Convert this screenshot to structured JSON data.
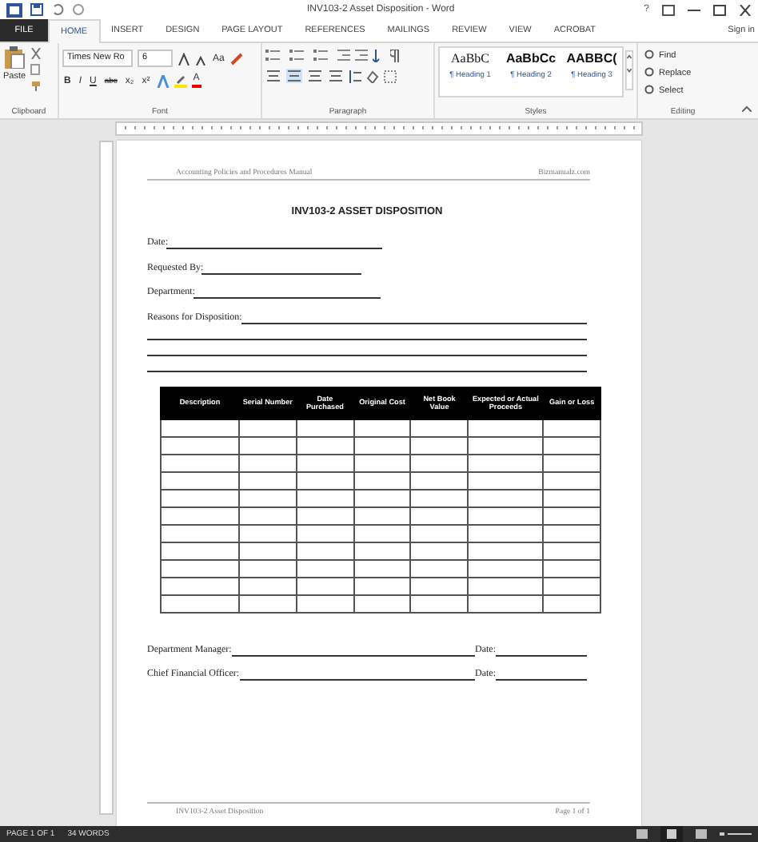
{
  "window": {
    "title": "INV103-2 Asset Disposition - Word",
    "help": "?"
  },
  "tabs": [
    {
      "label": "FILE",
      "kind": "file",
      "selected": false
    },
    {
      "label": "HOME",
      "kind": "tab",
      "selected": true
    },
    {
      "label": "INSERT",
      "kind": "tab",
      "selected": false
    },
    {
      "label": "DESIGN",
      "kind": "tab",
      "selected": false
    },
    {
      "label": "PAGE LAYOUT",
      "kind": "tab",
      "selected": false
    },
    {
      "label": "REFERENCES",
      "kind": "tab",
      "selected": false
    },
    {
      "label": "MAILINGS",
      "kind": "tab",
      "selected": false
    },
    {
      "label": "REVIEW",
      "kind": "tab",
      "selected": false
    },
    {
      "label": "VIEW",
      "kind": "tab",
      "selected": false
    },
    {
      "label": "ACROBAT",
      "kind": "tab",
      "selected": false
    }
  ],
  "account": "Sign in",
  "ribbon": {
    "clipboard": {
      "paste": "Paste",
      "group": "Clipboard"
    },
    "font": {
      "family": "Times New Ro",
      "size": "6",
      "case": "Aa",
      "buttons": [
        "B",
        "I",
        "U",
        "abc",
        "x₂",
        "x²"
      ],
      "color_button": "A",
      "group": "Font"
    },
    "paragraph": {
      "group": "Paragraph"
    },
    "styles": {
      "group": "Styles",
      "items": [
        {
          "sample": "AaBbC",
          "name": "¶ Heading 1",
          "kind": "serif"
        },
        {
          "sample": "AaBbCc",
          "name": "¶ Heading 2",
          "kind": "sans"
        },
        {
          "sample": "AABBC(",
          "name": "¶ Heading 3",
          "kind": "sans"
        }
      ]
    },
    "editing": {
      "group": "Editing",
      "items": [
        {
          "label": "Find"
        },
        {
          "label": "Replace"
        },
        {
          "label": "Select"
        }
      ]
    }
  },
  "document": {
    "header": {
      "left": "Accounting Policies and Procedures Manual",
      "right": "Bizmanualz.com"
    },
    "title": "INV103-2 ASSET DISPOSITION",
    "fields": [
      {
        "label": "Date:"
      },
      {
        "label": "Requested By:"
      },
      {
        "label": "Department:"
      }
    ],
    "reasons": {
      "label": "Reasons for Disposition:"
    },
    "table": {
      "columns": [
        "Description",
        "Serial Number",
        "Date Purchased",
        "Original Cost",
        "Net Book Value",
        "Expected or Actual Proceeds",
        "Gain or Loss"
      ]
    },
    "signatures": [
      {
        "label": "Department Manager:",
        "date_label": "Date:"
      },
      {
        "label": "Chief Financial Officer:",
        "date_label": "Date:"
      }
    ],
    "footer": {
      "left": "INV103-2 Asset Disposition",
      "right": "Page 1 of 1"
    }
  },
  "status_bar": {
    "page": "PAGE 1 OF 1",
    "words": "34 WORDS"
  }
}
